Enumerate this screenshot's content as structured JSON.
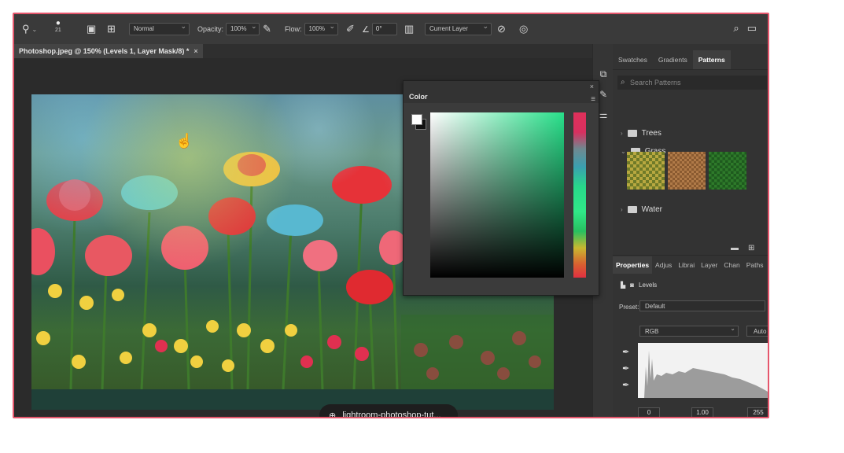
{
  "options_bar": {
    "brush_size": "21",
    "mode": "Normal",
    "opacity_label": "Opacity:",
    "opacity_value": "100%",
    "flow_label": "Flow:",
    "flow_value": "100%",
    "angle_value": "0°",
    "sample": "Current Layer"
  },
  "document": {
    "tab_title": "Photoshop.jpeg @ 150% (Levels 1, Layer Mask/8) *",
    "close": "×"
  },
  "link_pill": {
    "text": "lightroom-photoshop-tut..."
  },
  "color_panel": {
    "title": "Color",
    "close": "×",
    "collapse": "«"
  },
  "patterns_panel": {
    "tabs": [
      "Swatches",
      "Gradients",
      "Patterns"
    ],
    "active_tab": "Patterns",
    "search_placeholder": "Search Patterns",
    "folders": [
      {
        "name": "Trees",
        "expanded": false
      },
      {
        "name": "Grass",
        "expanded": true
      },
      {
        "name": "Water",
        "expanded": false
      }
    ]
  },
  "properties_panel": {
    "tabs": [
      "Properties",
      "Adjus",
      "Librai",
      "Layer",
      "Chan",
      "Paths"
    ],
    "active_tab": "Properties",
    "adjustment": "Levels",
    "preset_label": "Preset:",
    "preset_value": "Default",
    "channel": "RGB",
    "auto_label": "Auto",
    "input_black": "0",
    "input_gamma": "1.00",
    "input_white": "255"
  },
  "colors": {
    "frame_border": "#e5566c",
    "ui_bg": "#2a2a2a"
  }
}
